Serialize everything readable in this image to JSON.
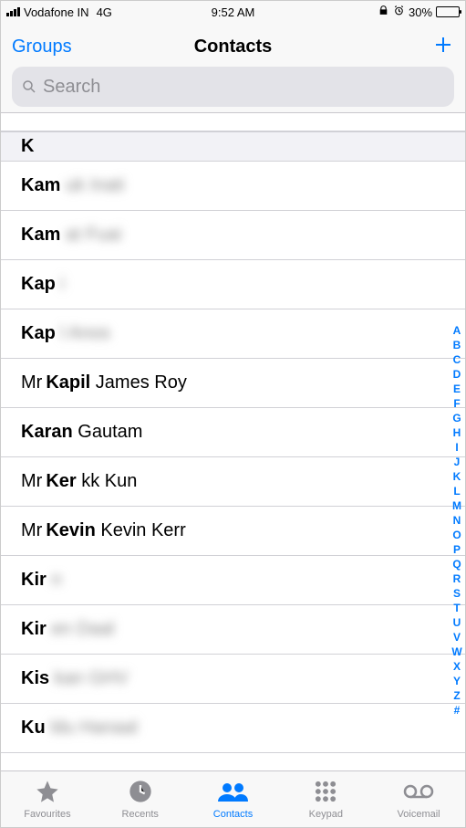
{
  "status": {
    "carrier": "Vodafone IN",
    "net": "4G",
    "time": "9:52 AM",
    "battery": "30%"
  },
  "nav": {
    "left": "Groups",
    "title": "Contacts"
  },
  "search": {
    "placeholder": "Search"
  },
  "section": "K",
  "contacts": [
    {
      "prefix": "",
      "first": "Kam",
      "rest": "uk Inati",
      "blur": true
    },
    {
      "prefix": "",
      "first": "Kam",
      "rest": "at Fuai",
      "blur": true
    },
    {
      "prefix": "",
      "first": "Kap",
      "rest": "i",
      "blur": true
    },
    {
      "prefix": "",
      "first": "Kap",
      "rest": "l Anos",
      "blur": true
    },
    {
      "prefix": "Mr",
      "first": "Kapil",
      "rest": "James Roy",
      "blur": false
    },
    {
      "prefix": "",
      "first": "Karan",
      "rest": "Gautam",
      "blur": false
    },
    {
      "prefix": "Mr",
      "first": "Ker",
      "rest": "kk Kun",
      "blur": false
    },
    {
      "prefix": "Mr",
      "first": "Kevin",
      "rest": "Kevin Kerr",
      "blur": false
    },
    {
      "prefix": "",
      "first": "Kir",
      "rest": "n",
      "blur": true
    },
    {
      "prefix": "",
      "first": "Kir",
      "rest": "en Daal",
      "blur": true
    },
    {
      "prefix": "",
      "first": "Kis",
      "rest": "kan GHV",
      "blur": true
    },
    {
      "prefix": "",
      "first": "Ku",
      "rest": "ldu Hanaal",
      "blur": true
    }
  ],
  "index": [
    "A",
    "B",
    "C",
    "D",
    "E",
    "F",
    "G",
    "H",
    "I",
    "J",
    "K",
    "L",
    "M",
    "N",
    "O",
    "P",
    "Q",
    "R",
    "S",
    "T",
    "U",
    "V",
    "W",
    "X",
    "Y",
    "Z",
    "#"
  ],
  "tabs": [
    {
      "label": "Favourites",
      "active": false
    },
    {
      "label": "Recents",
      "active": false
    },
    {
      "label": "Contacts",
      "active": true
    },
    {
      "label": "Keypad",
      "active": false
    },
    {
      "label": "Voicemail",
      "active": false
    }
  ]
}
